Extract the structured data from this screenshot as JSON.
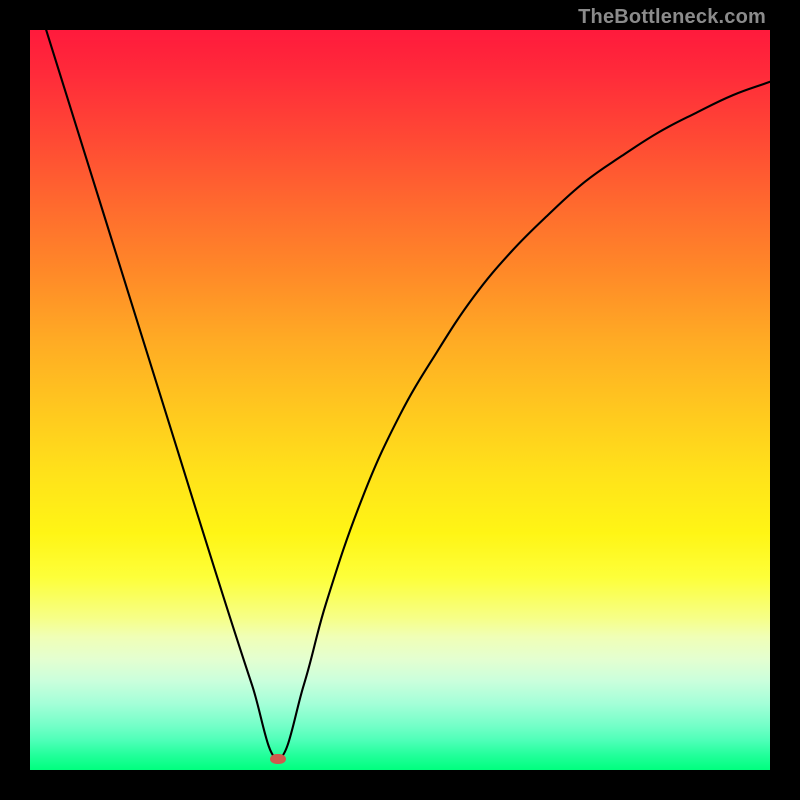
{
  "watermark": {
    "text": "TheBottleneck.com"
  },
  "colors": {
    "frame_bg": "#000000",
    "gradient_top": "#ff1a3c",
    "gradient_mid": "#ffe21a",
    "gradient_bottom": "#00ff7e",
    "curve_stroke": "#000000",
    "dot_fill": "#cf5a4d"
  },
  "marker": {
    "name": "bottleneck-point",
    "x_fraction": 0.335,
    "y_fraction": 0.985
  },
  "chart_data": {
    "type": "line",
    "title": "",
    "xlabel": "",
    "ylabel": "",
    "xlim": [
      0,
      1
    ],
    "ylim": [
      0,
      1
    ],
    "grid": false,
    "legend": false,
    "annotations": [
      "TheBottleneck.com"
    ],
    "series": [
      {
        "name": "bottleneck-curve",
        "x": [
          0.0,
          0.05,
          0.1,
          0.15,
          0.2,
          0.25,
          0.3,
          0.335,
          0.37,
          0.4,
          0.45,
          0.5,
          0.55,
          0.6,
          0.65,
          0.7,
          0.75,
          0.8,
          0.85,
          0.9,
          0.95,
          1.0
        ],
        "y": [
          1.07,
          0.91,
          0.75,
          0.59,
          0.43,
          0.27,
          0.115,
          0.015,
          0.115,
          0.225,
          0.37,
          0.48,
          0.565,
          0.64,
          0.7,
          0.75,
          0.795,
          0.83,
          0.862,
          0.888,
          0.912,
          0.93
        ]
      }
    ],
    "marker_point": {
      "x": 0.335,
      "y": 0.015
    }
  }
}
